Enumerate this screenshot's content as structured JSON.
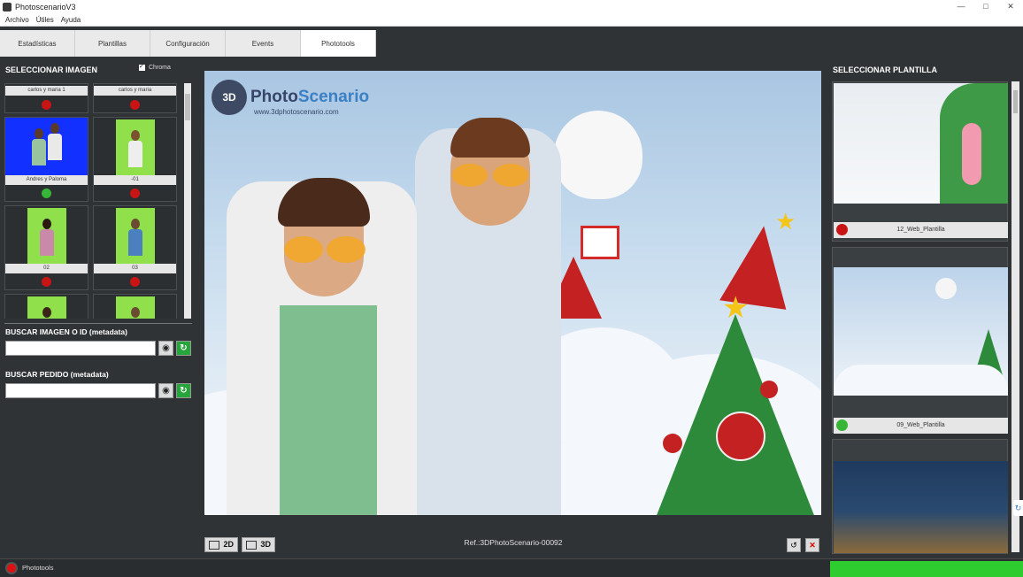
{
  "window": {
    "title": "PhotoscenarioV3",
    "controls": [
      "—",
      "□",
      "✕"
    ]
  },
  "menu": [
    "Archivo",
    "Útiles",
    "Ayuda"
  ],
  "tabs": [
    {
      "label": "Estadísticas"
    },
    {
      "label": "Plantillas"
    },
    {
      "label": "Configuración"
    },
    {
      "label": "Events"
    },
    {
      "label": "Phototools",
      "active": true
    }
  ],
  "left_panel": {
    "title": "SELECCIONAR IMAGEN",
    "chroma": {
      "label": "Chroma",
      "checked": true
    },
    "images": [
      {
        "caption": "carlos y maria 1",
        "status": "red",
        "partial": true
      },
      {
        "caption": "carlos y maria",
        "status": "red",
        "partial": true
      },
      {
        "caption": "Andres y Paloma",
        "status": "green",
        "bg": "blue"
      },
      {
        "caption": "-01",
        "status": "red",
        "bg": "green"
      },
      {
        "caption": "02",
        "status": "red",
        "bg": "green"
      },
      {
        "caption": "03",
        "status": "red",
        "bg": "green"
      },
      {
        "caption": "",
        "status": "",
        "bg": "green"
      },
      {
        "caption": "",
        "status": "",
        "bg": "green"
      }
    ],
    "search_image": {
      "title": "BUSCAR IMAGEN O ID (metadata)",
      "value": ""
    },
    "search_order": {
      "title": "BUSCAR PEDIDO (metadata)",
      "value": ""
    }
  },
  "center": {
    "watermark": {
      "brand_a": "Photo",
      "brand_b": "Scenario",
      "url": "www.3dphotoscenario.com",
      "cam": "3D"
    },
    "reference": "Ref.:3DPhotoScenario-00092",
    "buttons": {
      "view2d": "2D",
      "view3d": "3D"
    }
  },
  "right_panel": {
    "title": "SELECCIONAR PLANTILLA",
    "templates": [
      {
        "name": "12_Web_Plantilla",
        "status": "red"
      },
      {
        "name": "09_Web_Plantilla",
        "status": "green"
      },
      {
        "name": "",
        "status": ""
      }
    ]
  },
  "statusbar": {
    "label": "Phototools",
    "progress": 1.0
  },
  "colors": {
    "red_dot": "#c81414",
    "green_dot": "#36b536",
    "accent_green": "#2ecc2e"
  }
}
